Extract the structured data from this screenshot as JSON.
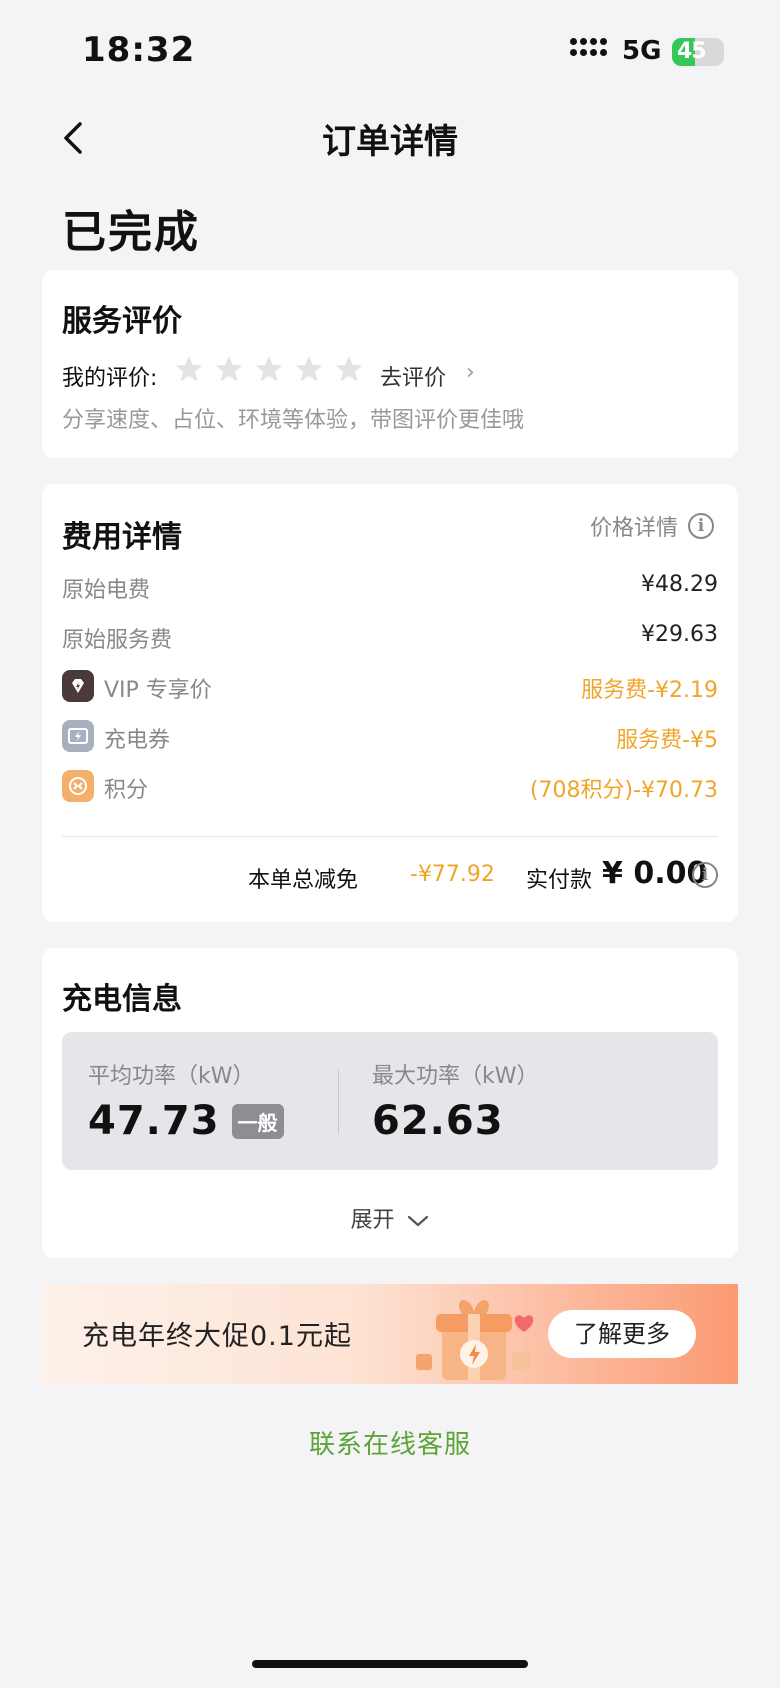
{
  "status_bar": {
    "time": "18:32",
    "network": "5G",
    "battery_level": "45",
    "battery_fraction": 0.45,
    "icons": [
      "signal-icon",
      "battery-charging-icon"
    ]
  },
  "nav": {
    "title": "订单详情",
    "back_icon": "chevron-left-icon"
  },
  "order_status": "已完成",
  "review": {
    "title": "服务评价",
    "my_review_label": "我的评价:",
    "rating": 0,
    "max_rating": 5,
    "go_review": "去评价",
    "arrow": "›",
    "hint": "分享速度、占位、环境等体验，带图评价更佳哦"
  },
  "fees": {
    "title": "费用详情",
    "price_detail_link": "价格详情",
    "rows": [
      {
        "label": "原始电费",
        "value": "¥48.29"
      },
      {
        "label": "原始服务费",
        "value": "¥29.63"
      },
      {
        "label": "VIP 专享价",
        "value": "服务费-¥2.19",
        "icon": "vip-icon"
      },
      {
        "label": "充电券",
        "value": "服务费-¥5",
        "icon": "coupon-icon"
      },
      {
        "label": "积分",
        "value": "(708积分)-¥70.73",
        "icon": "points-icon"
      }
    ],
    "total_discount_label": "本单总减免",
    "total_discount_value": "-¥77.92",
    "paid_label": "实付款",
    "paid_value": "¥ 0.00",
    "accent_color": "#f0a52a"
  },
  "charge_info": {
    "title": "充电信息",
    "avg_power_label": "平均功率（kW）",
    "avg_power_value": "47.73",
    "avg_power_badge": "一般",
    "max_power_label": "最大功率（kW）",
    "max_power_value": "62.63",
    "expand_label": "展开"
  },
  "promo": {
    "text": "充电年终大促0.1元起",
    "button": "了解更多"
  },
  "contact_link": "联系在线客服",
  "colors": {
    "link_green": "#5da437",
    "background": "#f4f4f6"
  }
}
